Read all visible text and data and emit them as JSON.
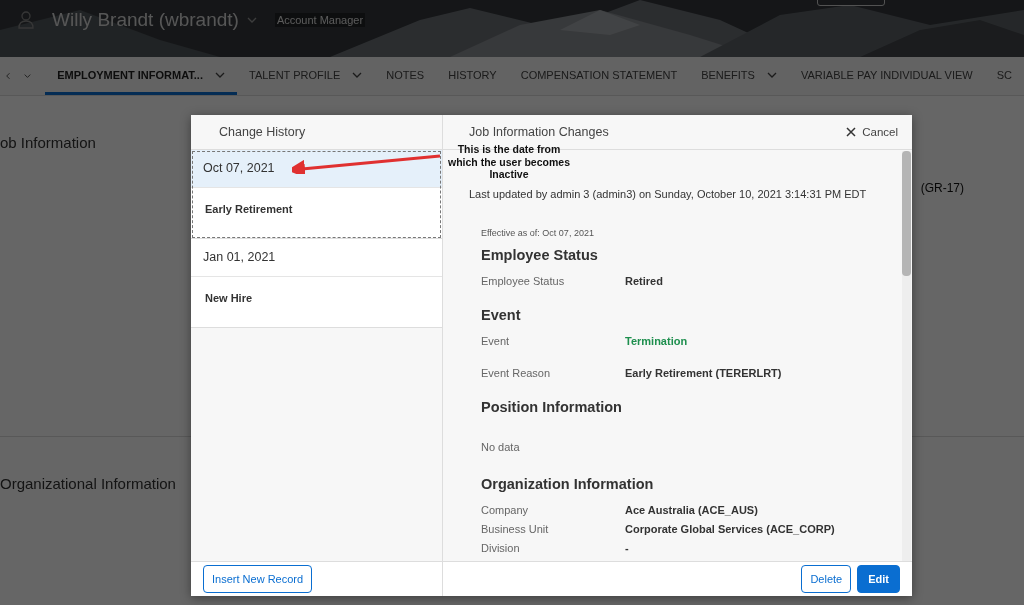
{
  "header": {
    "name": "Willy Brandt (wbrandt)",
    "role": "Account Manager"
  },
  "nav": {
    "tabs": [
      {
        "label": "EMPLOYMENT INFORMAT...",
        "selected": true,
        "has_menu": true
      },
      {
        "label": "TALENT PROFILE",
        "selected": false,
        "has_menu": true
      },
      {
        "label": "NOTES",
        "selected": false,
        "has_menu": false
      },
      {
        "label": "HISTORY",
        "selected": false,
        "has_menu": false
      },
      {
        "label": "COMPENSATION STATEMENT",
        "selected": false,
        "has_menu": false
      },
      {
        "label": "BENEFITS",
        "selected": false,
        "has_menu": true
      },
      {
        "label": "VARIABLE PAY INDIVIDUAL VIEW",
        "selected": false,
        "has_menu": false
      },
      {
        "label": "SC",
        "selected": false,
        "has_menu": false
      }
    ]
  },
  "background": {
    "sections": [
      {
        "title": "ob Information",
        "value": "(GR-17)"
      },
      {
        "title": "Organizational Information"
      }
    ]
  },
  "dialog": {
    "history": {
      "title": "Change History",
      "records": [
        {
          "date": "Oct 07, 2021",
          "event": "Early Retirement",
          "selected": true
        },
        {
          "date": "Jan 01, 2021",
          "event": "New Hire",
          "selected": false
        }
      ],
      "insert_button": "Insert New Record"
    },
    "details": {
      "title": "Job Information Changes",
      "cancel": "Cancel",
      "updated": "Last updated by admin 3 (admin3) on Sunday, October 10, 2021 3:14:31 PM EDT",
      "effective": "Effective as of: Oct 07, 2021",
      "sections": [
        {
          "heading": "Employee Status",
          "fields": [
            {
              "label": "Employee Status",
              "value": "Retired"
            }
          ]
        },
        {
          "heading": "Event",
          "fields": [
            {
              "label": "Event",
              "value": "Termination",
              "color": "#1e8f4e"
            },
            {
              "label": "Event Reason",
              "value": "Early Retirement (TERERLRT)"
            }
          ]
        },
        {
          "heading": "Position Information",
          "empty": "No data"
        },
        {
          "heading": "Organization Information",
          "fields": [
            {
              "label": "Company",
              "value": "Ace Australia (ACE_AUS)"
            },
            {
              "label": "Business Unit",
              "value": "Corporate Global Services (ACE_CORP)"
            },
            {
              "label": "Division",
              "value": "-"
            }
          ]
        }
      ],
      "delete_button": "Delete",
      "edit_button": "Edit"
    }
  },
  "annotation": {
    "text": "This is the date from which the user becomes Inactive"
  }
}
